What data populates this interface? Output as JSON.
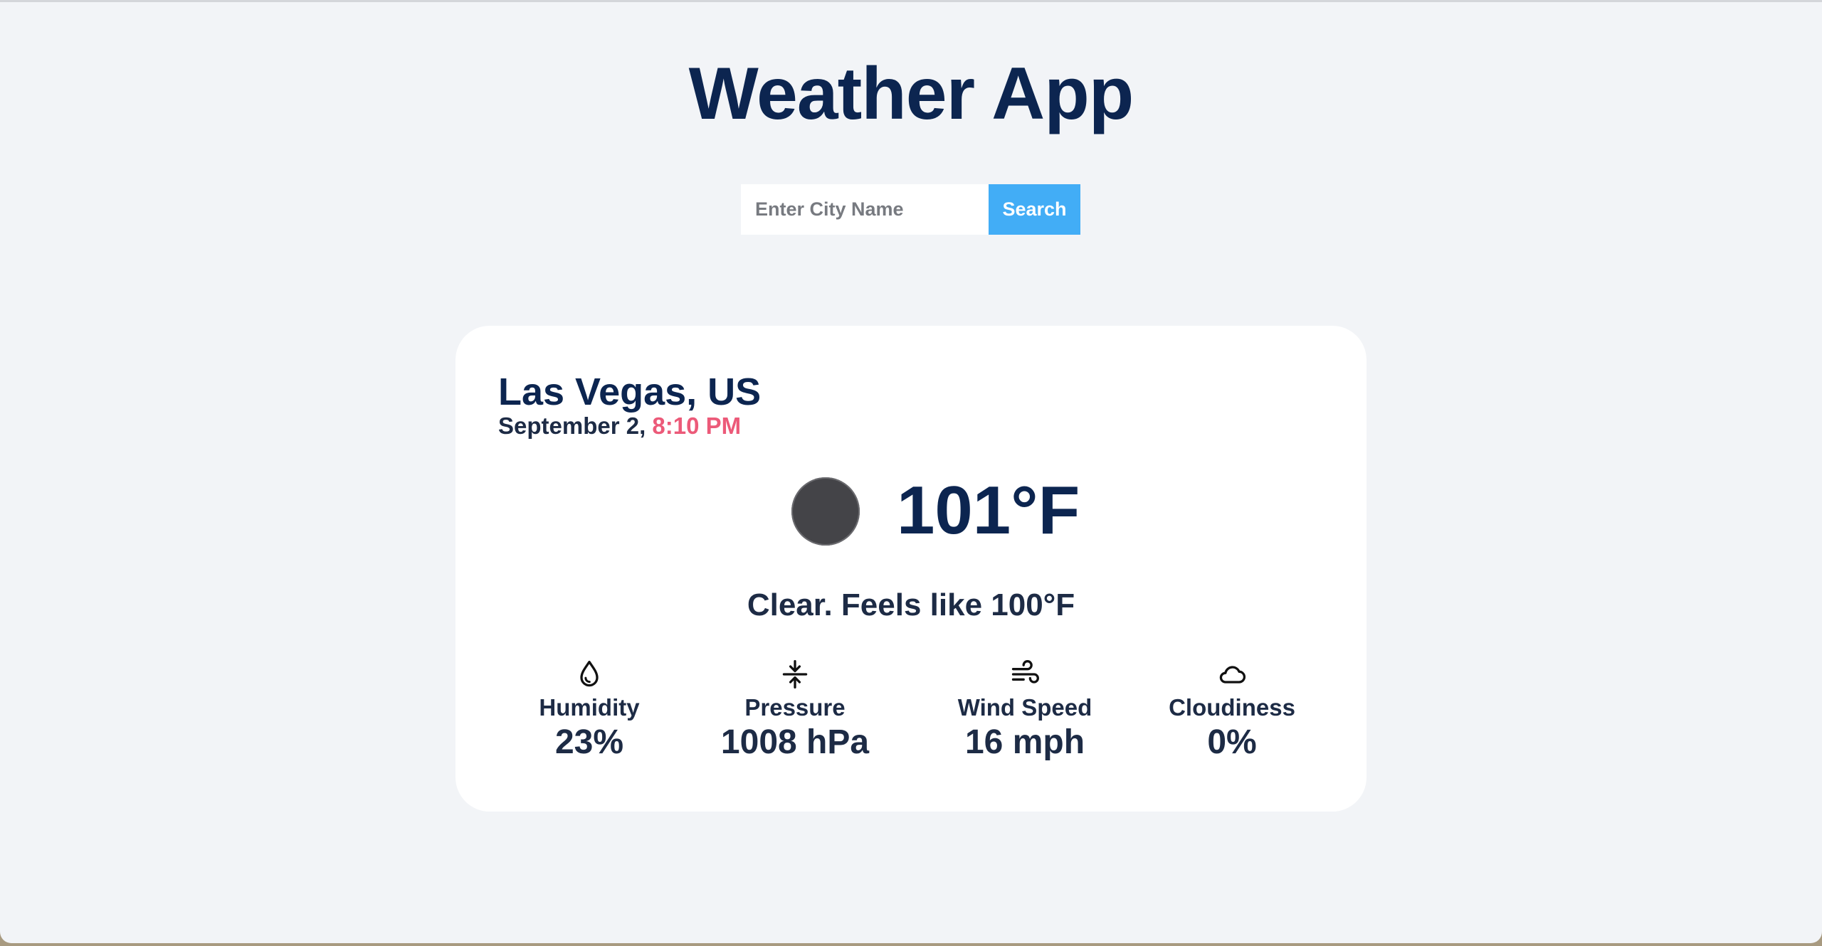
{
  "app": {
    "title": "Weather App"
  },
  "search": {
    "placeholder": "Enter City Name",
    "value": "",
    "button_label": "Search"
  },
  "weather": {
    "city": "Las Vegas, US",
    "date": "September 2,",
    "time": "8:10 PM",
    "icon": "clear-night-icon",
    "temperature": "101°F",
    "description": "Clear. Feels like 100°F"
  },
  "details": [
    {
      "icon": "humidity-icon",
      "label": "Humidity",
      "value": "23%"
    },
    {
      "icon": "pressure-icon",
      "label": "Pressure",
      "value": "1008 hPa"
    },
    {
      "icon": "wind-icon",
      "label": "Wind Speed",
      "value": "16 mph"
    },
    {
      "icon": "cloud-icon",
      "label": "Cloudiness",
      "value": "0%"
    }
  ],
  "colors": {
    "page_background": "#f2f4f7",
    "title": "#0c2550",
    "accent_button": "#42adf6",
    "time": "#ec5a79",
    "card": "#ffffff"
  }
}
